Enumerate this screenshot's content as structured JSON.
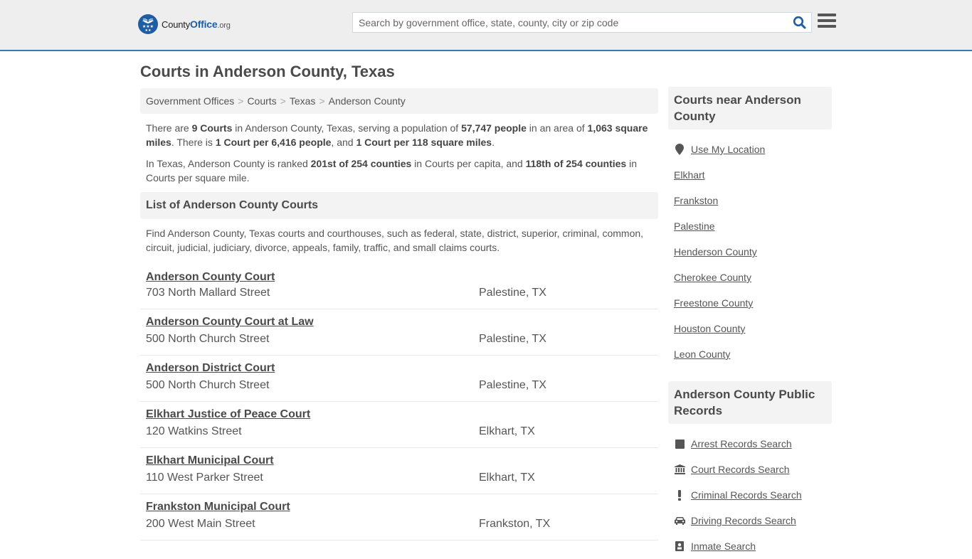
{
  "header": {
    "logo": {
      "county": "County",
      "office": "Office",
      "tld": ".org"
    },
    "search": {
      "placeholder": "Search by government office, state, county, city or zip code",
      "value": ""
    },
    "icons": {
      "search": "search-icon",
      "menu": "hamburger-menu-icon",
      "logo": "eagle-stars-logo-icon"
    },
    "accent_color": "#3b7ab0",
    "brand_color": "#1f5da3"
  },
  "page": {
    "title": "Courts in Anderson County, Texas",
    "breadcrumb": [
      "Government Offices",
      "Courts",
      "Texas",
      "Anderson County"
    ],
    "breadcrumb_separator": ">"
  },
  "intro": {
    "p1": {
      "t1": "There are ",
      "b1": "9 Courts",
      "t2": " in Anderson County, Texas, serving a population of ",
      "b2": "57,747 people",
      "t3": " in an area of ",
      "b3": "1,063 square miles",
      "t4": ". There is ",
      "b4": "1 Court per 6,416 people",
      "t5": ", and ",
      "b5": "1 Court per 118 square miles",
      "t6": "."
    },
    "p2": {
      "t1": "In Texas, Anderson County is ranked ",
      "b1": "201st of 254 counties",
      "t2": " in Courts per capita, and ",
      "b2": "118th of 254 counties",
      "t3": " in Courts per square mile."
    }
  },
  "list": {
    "heading": "List of Anderson County Courts",
    "description": "Find Anderson County, Texas courts and courthouses, such as federal, state, district, superior, criminal, common, circuit, judicial, judiciary, divorce, appeals, family, traffic, and small claims courts.",
    "courts": [
      {
        "name": "Anderson County Court",
        "address": "703 North Mallard Street",
        "city": "Palestine, TX"
      },
      {
        "name": "Anderson County Court at Law",
        "address": "500 North Church Street",
        "city": "Palestine, TX"
      },
      {
        "name": "Anderson District Court",
        "address": "500 North Church Street",
        "city": "Palestine, TX"
      },
      {
        "name": "Elkhart Justice of Peace Court",
        "address": "120 Watkins Street",
        "city": "Elkhart, TX"
      },
      {
        "name": "Elkhart Municipal Court",
        "address": "110 West Parker Street",
        "city": "Elkhart, TX"
      },
      {
        "name": "Frankston Municipal Court",
        "address": "200 West Main Street",
        "city": "Frankston, TX"
      }
    ]
  },
  "sidebar": {
    "nearby": {
      "heading": "Courts near Anderson County",
      "use_location": {
        "label": "Use My Location",
        "icon": "map-marker-icon"
      },
      "links": [
        "Elkhart",
        "Frankston",
        "Palestine",
        "Henderson County",
        "Cherokee County",
        "Freestone County",
        "Houston County",
        "Leon County"
      ]
    },
    "records": {
      "heading": "Anderson County Public Records",
      "links": [
        {
          "label": "Arrest Records Search",
          "icon": "square-icon"
        },
        {
          "label": "Court Records Search",
          "icon": "courthouse-icon"
        },
        {
          "label": "Criminal Records Search",
          "icon": "exclamation-icon"
        },
        {
          "label": "Driving Records Search",
          "icon": "car-icon"
        },
        {
          "label": "Inmate Search",
          "icon": "inmate-icon"
        }
      ]
    }
  }
}
